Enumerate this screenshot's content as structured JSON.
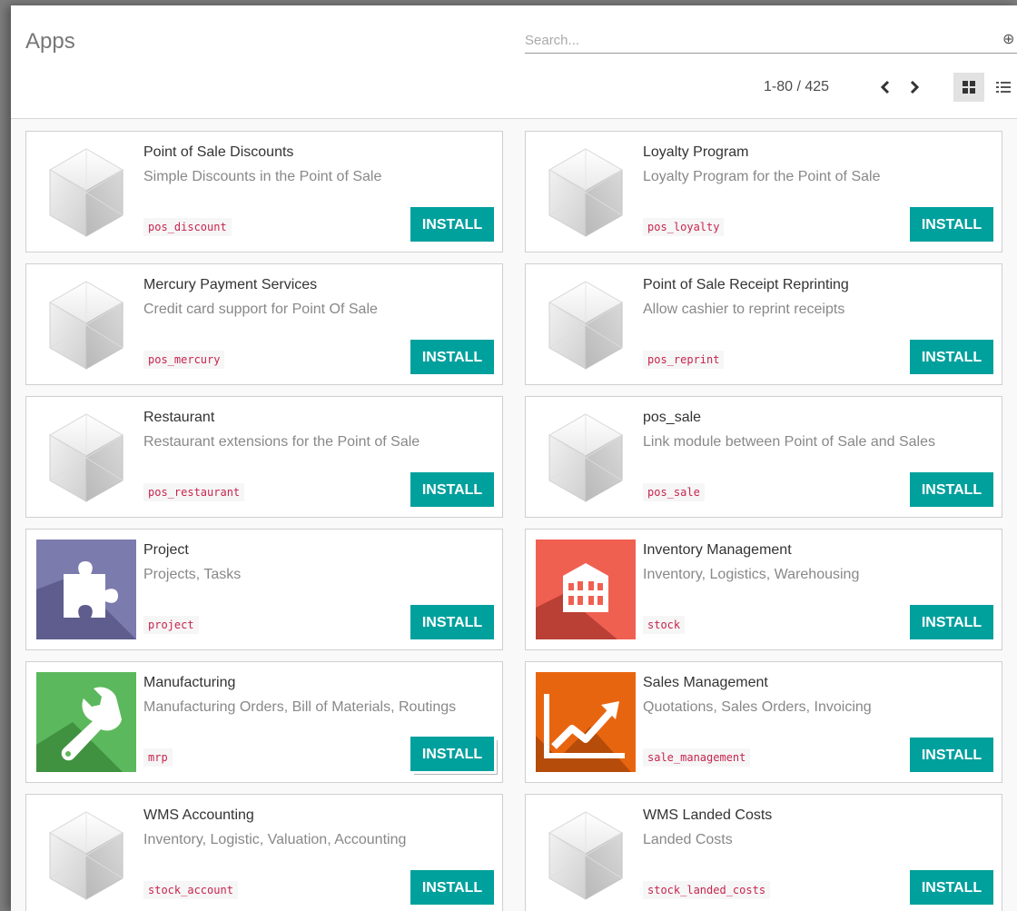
{
  "header": {
    "title": "Apps",
    "search_placeholder": "Search...",
    "pager": "1-80 / 425",
    "icons": {
      "search_toggle": "circle-plus-icon",
      "prev": "chevron-left-icon",
      "next": "chevron-right-icon",
      "kanban_view": "kanban-view-icon",
      "list_view": "list-view-icon"
    }
  },
  "colors": {
    "install": "#00a09d",
    "tech_name": "#c7254e",
    "project_icon": "#7c7bad",
    "stock_icon": "#f06050",
    "mrp_icon": "#5cb85c",
    "sales_icon": "#e8650f"
  },
  "apps": [
    {
      "name": "Point of Sale Discounts",
      "summary": "Simple Discounts in the Point of Sale",
      "tech": "pos_discount",
      "button": "INSTALL",
      "icon": "cube-placeholder-icon"
    },
    {
      "name": "Loyalty Program",
      "summary": "Loyalty Program for the Point of Sale",
      "tech": "pos_loyalty",
      "button": "INSTALL",
      "icon": "cube-placeholder-icon"
    },
    {
      "name": "Mercury Payment Services",
      "summary": "Credit card support for Point Of Sale",
      "tech": "pos_mercury",
      "button": "INSTALL",
      "icon": "cube-placeholder-icon"
    },
    {
      "name": "Point of Sale Receipt Reprinting",
      "summary": "Allow cashier to reprint receipts",
      "tech": "pos_reprint",
      "button": "INSTALL",
      "icon": "cube-placeholder-icon"
    },
    {
      "name": "Restaurant",
      "summary": "Restaurant extensions for the Point of Sale",
      "tech": "pos_restaurant",
      "button": "INSTALL",
      "icon": "cube-placeholder-icon"
    },
    {
      "name": "pos_sale",
      "summary": "Link module between Point of Sale and Sales",
      "tech": "pos_sale",
      "button": "INSTALL",
      "icon": "cube-placeholder-icon"
    },
    {
      "name": "Project",
      "summary": "Projects, Tasks",
      "tech": "project",
      "button": "INSTALL",
      "icon": "puzzle-piece-icon"
    },
    {
      "name": "Inventory Management",
      "summary": "Inventory, Logistics, Warehousing",
      "tech": "stock",
      "button": "INSTALL",
      "icon": "warehouse-building-icon"
    },
    {
      "name": "Manufacturing",
      "summary": "Manufacturing Orders, Bill of Materials, Routings",
      "tech": "mrp",
      "button": "INSTALL",
      "icon": "wrench-icon"
    },
    {
      "name": "Sales Management",
      "summary": "Quotations, Sales Orders, Invoicing",
      "tech": "sale_management",
      "button": "INSTALL",
      "icon": "trend-chart-icon"
    },
    {
      "name": "WMS Accounting",
      "summary": "Inventory, Logistic, Valuation, Accounting",
      "tech": "stock_account",
      "button": "INSTALL",
      "icon": "cube-placeholder-icon"
    },
    {
      "name": "WMS Landed Costs",
      "summary": "Landed Costs",
      "tech": "stock_landed_costs",
      "button": "INSTALL",
      "icon": "cube-placeholder-icon"
    }
  ]
}
